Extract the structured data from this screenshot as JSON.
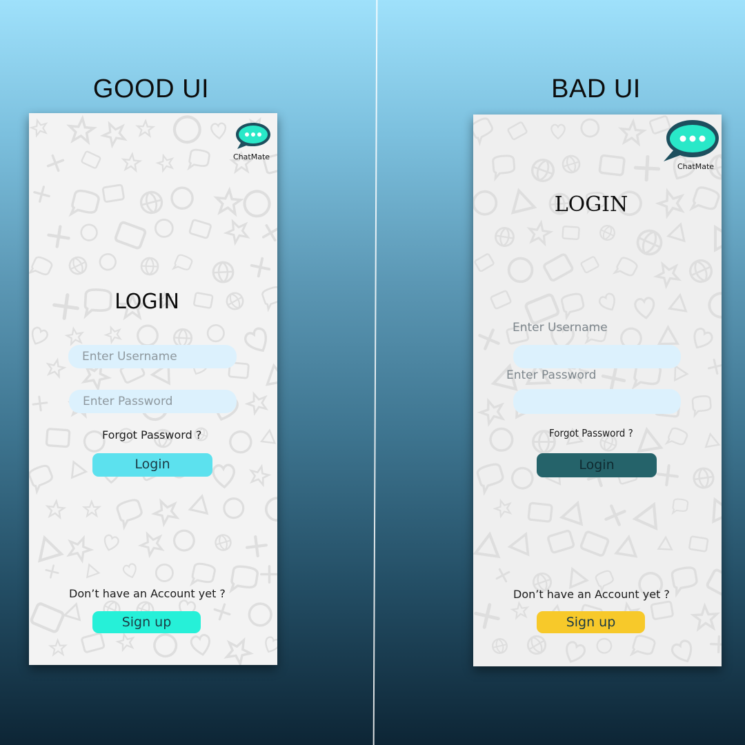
{
  "left_panel": {
    "heading": "GOOD UI",
    "app_name": "ChatMate",
    "title": "LOGIN",
    "username_placeholder": "Enter Username",
    "password_placeholder": "Enter Password",
    "forgot_password": "Forgot Password ?",
    "login_label": "Login",
    "signup_prompt": "Don’t have an Account yet ?",
    "signup_label": "Sign up"
  },
  "right_panel": {
    "heading": "BAD UI",
    "app_name": "ChatMate",
    "title": "LOGIN",
    "username_label": "Enter Username",
    "password_label": "Enter Password",
    "forgot_password": "Forgot Password ?",
    "login_label": "Login",
    "signup_prompt": "Don’t have an Account yet ?",
    "signup_label": "Sign up"
  },
  "colors": {
    "logo_bubble": "#1d4f5e",
    "logo_inner": "#29e8c8",
    "good_login_button": "#5ce1ee",
    "good_signup_button": "#26f0d8",
    "bad_login_button": "#25636a",
    "bad_signup_button": "#f7c92a",
    "input_fill": "#dcf1fd"
  },
  "icons": {
    "logo": "chat-bubble-icon",
    "background": "doodle-pattern"
  }
}
